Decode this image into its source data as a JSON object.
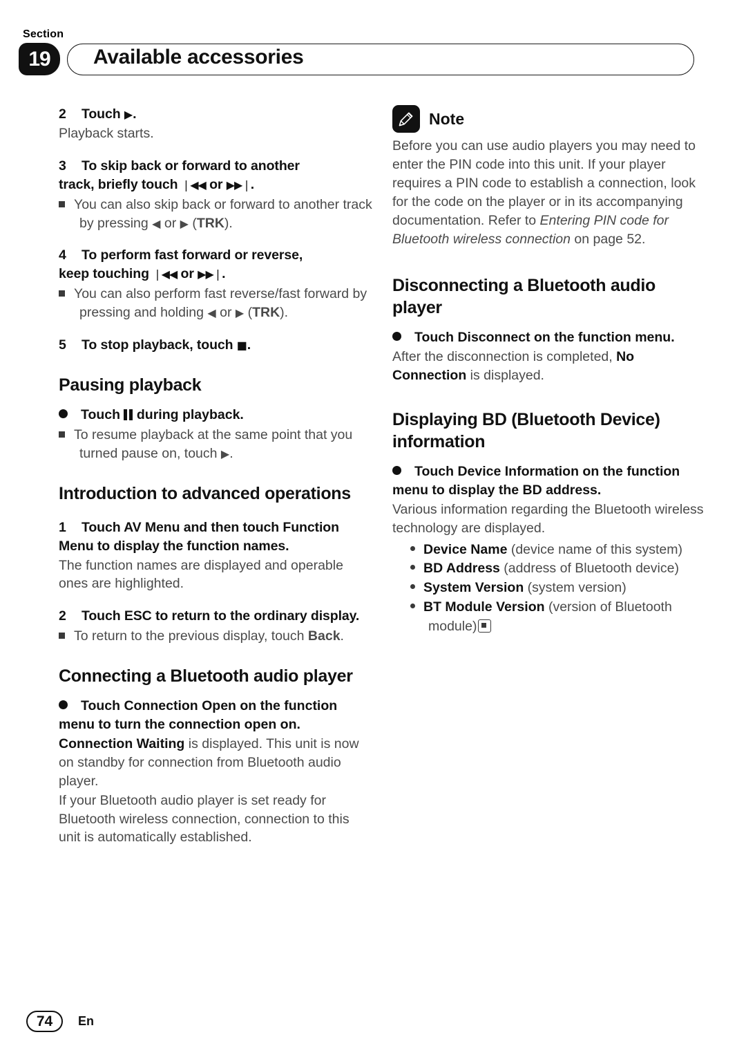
{
  "header": {
    "section_word": "Section",
    "section_number": "19",
    "title": "Available accessories"
  },
  "left_column": {
    "step2": {
      "num": "2",
      "text_before": "Touch",
      "glyph": "play-icon",
      "text_after": ".",
      "desc": "Playback starts."
    },
    "step3": {
      "num": "3",
      "line1": "To skip back or forward to another",
      "line2_a": "track, briefly touch",
      "glyph1": "skip-back-icon",
      "line2_b": "or",
      "glyph2": "skip-forward-icon",
      "line2_c": ".",
      "note_a": "You can also skip back or forward to another track by pressing",
      "note_glyph1": "left-arrow-icon",
      "note_b": "or",
      "note_glyph2": "right-arrow-icon",
      "note_c": "(",
      "note_bold": "TRK",
      "note_d": ")."
    },
    "step4": {
      "num": "4",
      "line1": "To perform fast forward or reverse,",
      "line2_a": "keep touching",
      "glyph1": "skip-back-icon",
      "line2_b": "or",
      "glyph2": "skip-forward-icon",
      "line2_c": ".",
      "note_a": "You can also perform fast reverse/fast forward by pressing and holding",
      "note_glyph1": "left-arrow-icon",
      "note_b": "or",
      "note_glyph2": "right-arrow-icon",
      "note_c": "(",
      "note_bold": "TRK",
      "note_d": ")."
    },
    "step5": {
      "num": "5",
      "text": "To stop playback, touch",
      "glyph": "stop-icon",
      "text_after": "."
    },
    "pausing": {
      "heading": "Pausing playback",
      "bullet_a": "Touch",
      "bullet_glyph": "pause-icon",
      "bullet_b": "during playback.",
      "note_a": "To resume playback at the same point that you turned pause on, touch",
      "note_glyph": "play-icon",
      "note_b": "."
    },
    "intro_advanced": {
      "heading": "Introduction to advanced operations",
      "step1_num": "1",
      "step1": "Touch AV Menu and then touch Function Menu to display the function names.",
      "step1_desc": "The function names are displayed and operable ones are highlighted.",
      "step2_num": "2",
      "step2": "Touch ESC to return to the ordinary display.",
      "step2_note_a": "To return to the previous display, touch",
      "step2_note_bold": "Back",
      "step2_note_b": "."
    },
    "connecting": {
      "heading": "Connecting a Bluetooth audio player",
      "bullet": "Touch Connection Open on the function menu to turn the connection open on.",
      "para1_bold": "Connection Waiting",
      "para1_rest": " is displayed. This unit is now on standby for connection from Bluetooth audio player.",
      "para2": "If your Bluetooth audio player is set ready for Bluetooth wireless connection, connection to this unit is automatically established."
    }
  },
  "right_column": {
    "note": {
      "icon": "pencil-icon",
      "label": "Note",
      "text_a": "Before you can use audio players you may need to enter the PIN code into this unit. If your player requires a PIN code to establish a connection, look for the code on the player or in its accompanying documentation. Refer to ",
      "italic": "Entering PIN code for Bluetooth wireless connection",
      "text_b": " on page 52."
    },
    "disconnecting": {
      "heading": "Disconnecting a Bluetooth audio player",
      "bullet": "Touch Disconnect on the function menu.",
      "desc_a": "After the disconnection is completed, ",
      "desc_bold": "No Connection",
      "desc_b": " is displayed."
    },
    "displaying_bd": {
      "heading": "Displaying BD (Bluetooth Device) information",
      "bullet": "Touch Device Information on the function menu to display the BD address.",
      "desc": "Various information regarding the Bluetooth wireless technology are displayed.",
      "items": [
        {
          "term": "Device Name",
          "desc": " (device name of this system)"
        },
        {
          "term": "BD Address",
          "desc": " (address of Bluetooth device)"
        },
        {
          "term": "System Version",
          "desc": " (system version)"
        },
        {
          "term": "BT Module Version",
          "desc": " (version of Bluetooth module)"
        }
      ],
      "end_marker": "end-of-section-icon"
    }
  },
  "footer": {
    "page_number": "74",
    "language": "En"
  }
}
